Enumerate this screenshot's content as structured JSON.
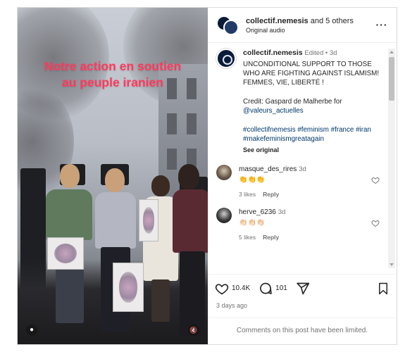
{
  "video": {
    "overlay_line1": "Notre action en soutien",
    "overlay_line2": "au peuple iranien"
  },
  "header": {
    "username": "collectif.nemesis",
    "others": " and 5 others",
    "audio": "Original audio"
  },
  "caption": {
    "username": "collectif.nemesis",
    "meta": "Edited • 3d",
    "line1": "UNCONDITIONAL SUPPORT TO THOSE WHO ARE FIGHTING AGAINST ISLAMISM!",
    "line2": " FEMMES, VIE, LIBERTÉ !",
    "credit": "Credit: Gaspard de Malherbe for",
    "credit_link": "@valeurs_actuelles",
    "hashtags": "#collectifnemesis #feminism #france #iran #makefeminismgreatagain",
    "see_original": "See original"
  },
  "comments": [
    {
      "username": "masque_des_rires",
      "time": "3d",
      "text": "👏👏👏",
      "likes": "3 likes",
      "reply": "Reply"
    },
    {
      "username": "herve_6236",
      "time": "3d",
      "text": "👏🏻👏🏻👏🏻",
      "likes": "5 likes",
      "reply": "Reply"
    }
  ],
  "actions": {
    "likes": "10.4K",
    "comments": "101"
  },
  "posted": "3 days ago",
  "limited": "Comments on this post have been limited."
}
